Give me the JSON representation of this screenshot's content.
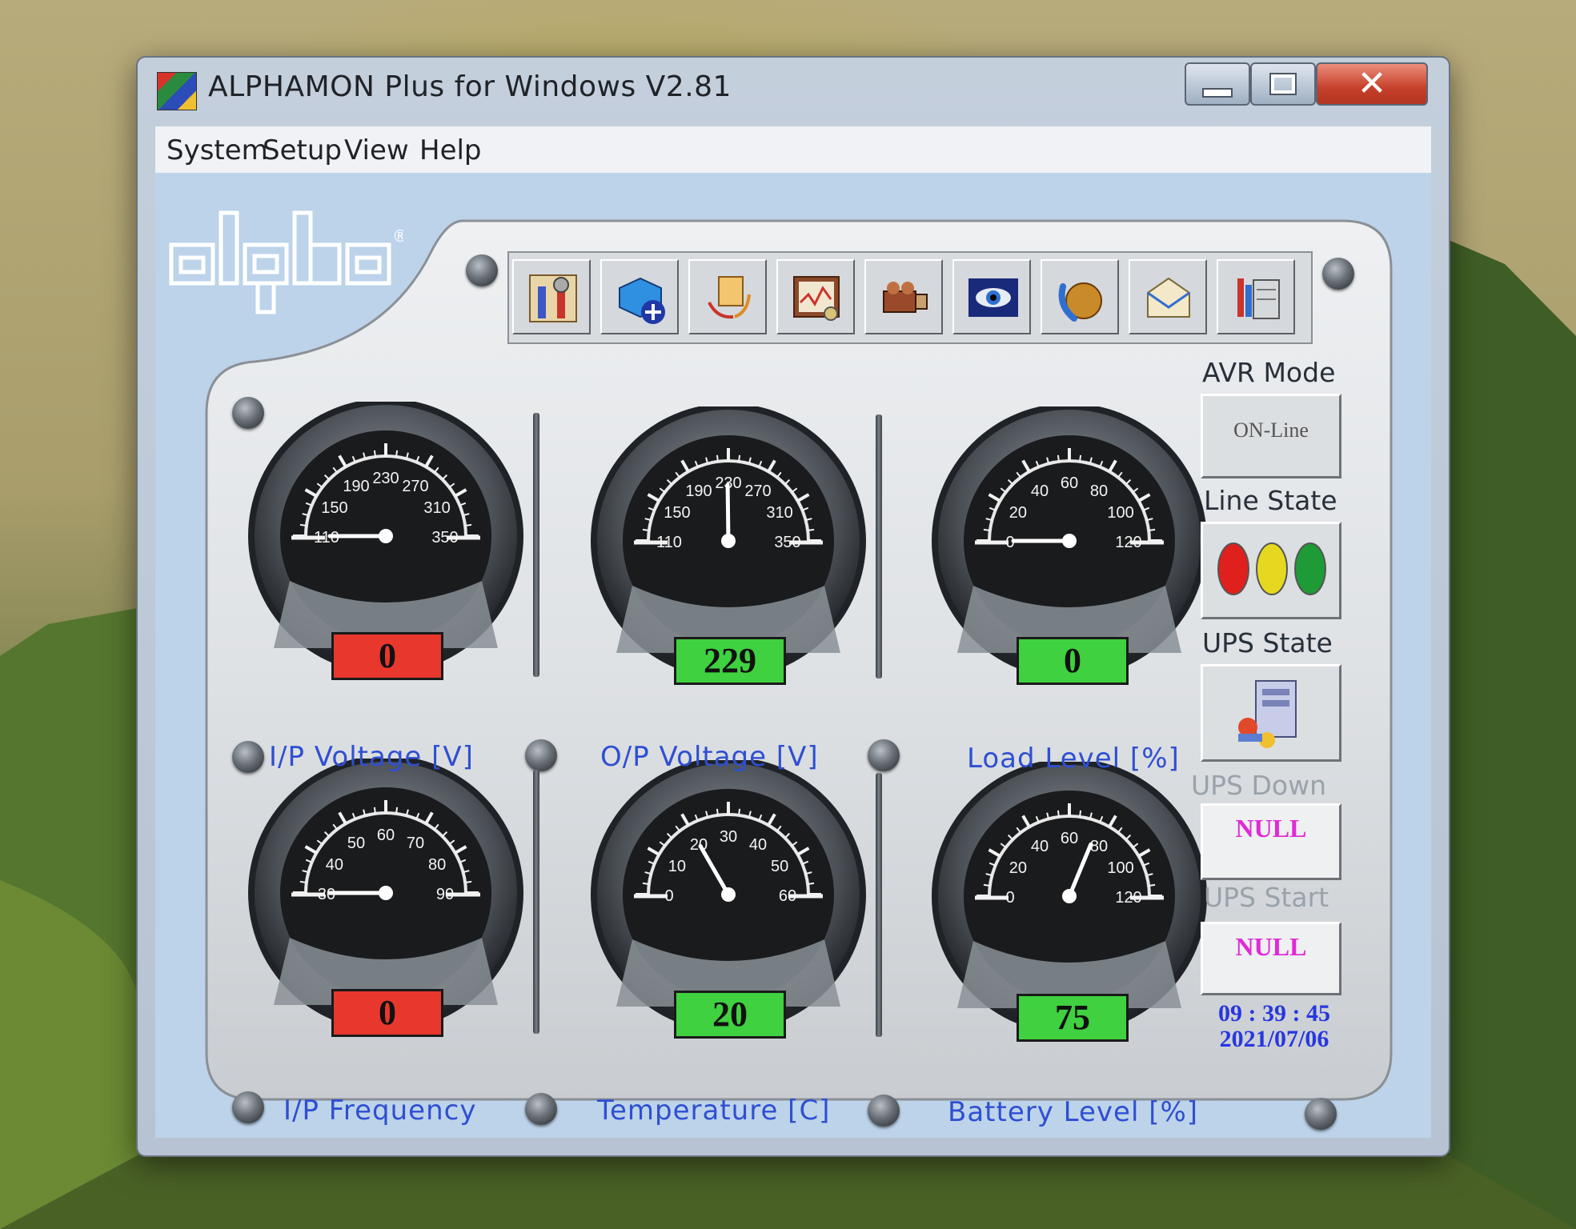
{
  "window": {
    "title": "ALPHAMON Plus for Windows V2.81"
  },
  "menu": [
    "System",
    "Setup",
    "View",
    "Help"
  ],
  "toolbar": [
    {
      "icon": "tools-settings-icon"
    },
    {
      "icon": "add-device-icon"
    },
    {
      "icon": "transfer-icon"
    },
    {
      "icon": "event-log-icon"
    },
    {
      "icon": "camera-icon"
    },
    {
      "icon": "monitor-eye-icon"
    },
    {
      "icon": "phone-icon"
    },
    {
      "icon": "email-icon"
    },
    {
      "icon": "configuration-icon"
    }
  ],
  "gauges": [
    {
      "label": "I/P Voltage [V]",
      "ticks": [
        "110",
        "150",
        "190",
        "230",
        "270",
        "310",
        "350"
      ],
      "min": 110,
      "max": 350,
      "value": 0,
      "readout": "0",
      "readout_color": "#e8372c"
    },
    {
      "label": "O/P Voltage [V]",
      "ticks": [
        "110",
        "150",
        "190",
        "230",
        "270",
        "310",
        "350"
      ],
      "min": 110,
      "max": 350,
      "value": 229,
      "readout": "229",
      "readout_color": "#3fd13f"
    },
    {
      "label": "Load Level [%]",
      "ticks": [
        "0",
        "20",
        "40",
        "60",
        "80",
        "100",
        "120"
      ],
      "min": 0,
      "max": 120,
      "value": 0,
      "readout": "0",
      "readout_color": "#3fd13f"
    },
    {
      "label": "I/P Frequency",
      "ticks": [
        "30",
        "40",
        "50",
        "60",
        "70",
        "80",
        "90"
      ],
      "min": 30,
      "max": 90,
      "value": 0,
      "readout": "0",
      "readout_color": "#e8372c"
    },
    {
      "label": "Temperature [C]",
      "ticks": [
        "0",
        "10",
        "20",
        "30",
        "40",
        "50",
        "60"
      ],
      "min": 0,
      "max": 60,
      "value": 20,
      "readout": "20",
      "readout_color": "#3fd13f"
    },
    {
      "label": "Battery Level [%]",
      "ticks": [
        "0",
        "20",
        "40",
        "60",
        "80",
        "100",
        "120"
      ],
      "min": 0,
      "max": 120,
      "value": 75,
      "readout": "75",
      "readout_color": "#3fd13f"
    }
  ],
  "status": {
    "avr_mode": {
      "label": "AVR Mode",
      "value": "ON-Line"
    },
    "line_state": {
      "label": "Line State",
      "lights": [
        "#e0201c",
        "#e6d820",
        "#1e9a36"
      ]
    },
    "ups_state": {
      "label": "UPS State",
      "icon": "ups-computer-icon"
    },
    "ups_down": {
      "label": "UPS Down",
      "value": "NULL"
    },
    "ups_start": {
      "label": "UPS Start",
      "value": "NULL"
    },
    "time": "09 : 39 : 45",
    "date": "2021/07/06"
  }
}
